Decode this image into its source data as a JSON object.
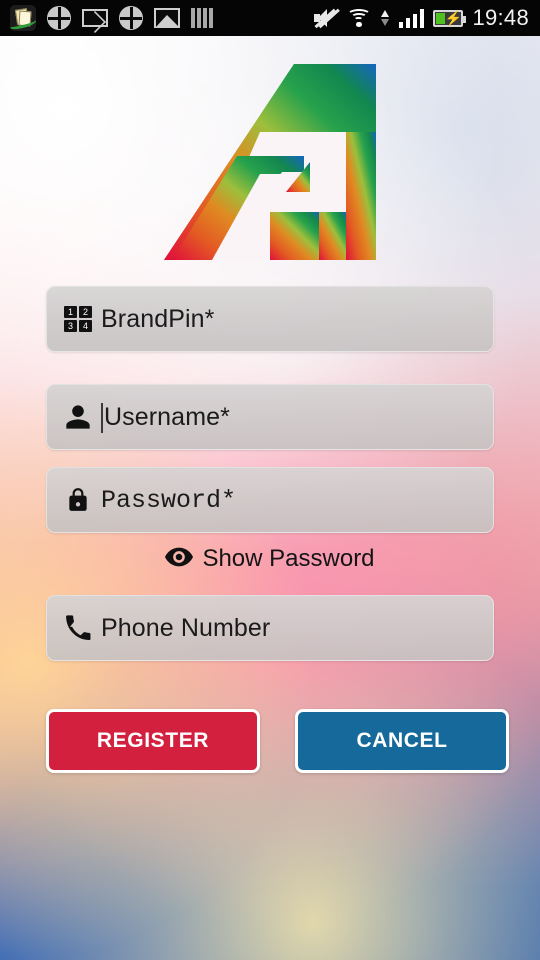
{
  "status_bar": {
    "time": "19:48",
    "left_icons": [
      "notes-app-icon",
      "clover-icon",
      "envelope-icon",
      "clover-icon",
      "gallery-icon",
      "bars-icon"
    ],
    "right_icons": [
      "mute-icon",
      "wifi-icon",
      "data-transfer-icon",
      "signal-icon",
      "battery-charging-icon"
    ],
    "battery_level_percent": 30
  },
  "app": {
    "logo_name": "brand-a-logo",
    "logo_gradient": {
      "from": "#e0103a",
      "mid1": "#e87b20",
      "mid2": "#8ec33f",
      "mid3": "#0f9d58",
      "to": "#1565c0"
    }
  },
  "form": {
    "fields": [
      {
        "name": "brandpin",
        "icon": "keypad-icon",
        "placeholder": "BrandPin*",
        "value": "",
        "focused": false,
        "mono": false
      },
      {
        "name": "username",
        "icon": "user-icon",
        "placeholder": "Username*",
        "value": "",
        "focused": true,
        "mono": false
      },
      {
        "name": "password",
        "icon": "lock-icon",
        "placeholder": "Password*",
        "value": "",
        "focused": false,
        "mono": true
      },
      {
        "name": "phone",
        "icon": "phone-icon",
        "placeholder": "Phone Number",
        "value": "",
        "focused": false,
        "mono": false
      }
    ],
    "show_password": {
      "icon": "eye-icon",
      "label": "Show Password",
      "checked": false
    },
    "keypad_icon_digits": [
      "1",
      "2",
      "3",
      "4"
    ]
  },
  "buttons": {
    "register": {
      "label": "REGISTER",
      "color": "#d3203f"
    },
    "cancel": {
      "label": "CANCEL",
      "color": "#16699b"
    }
  }
}
